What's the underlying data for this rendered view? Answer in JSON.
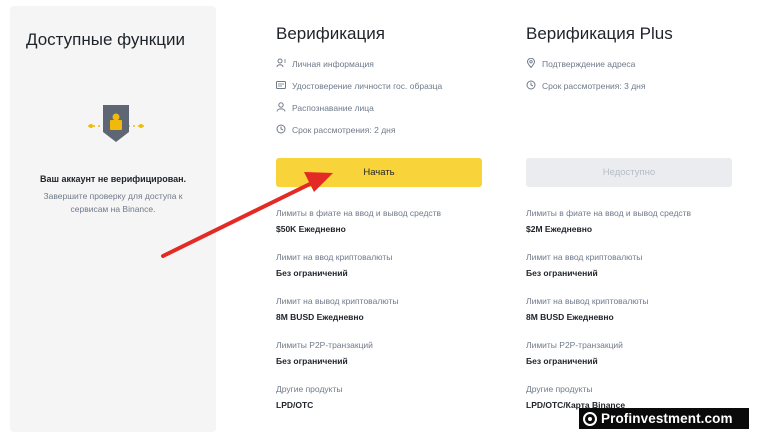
{
  "left_panel": {
    "title": "Доступные функции",
    "status": "Ваш аккаунт не верифицирован.",
    "description": "Завершите проверку для доступа к сервисам на Binance."
  },
  "verification": {
    "title": "Верификация",
    "features": [
      {
        "icon": "user-info-icon",
        "label": "Личная информация"
      },
      {
        "icon": "id-card-icon",
        "label": "Удостоверение личности гос. образца"
      },
      {
        "icon": "face-icon",
        "label": "Распознавание лица"
      },
      {
        "icon": "clock-icon",
        "label": "Срок рассмотрения: 2 дня"
      }
    ],
    "button_label": "Начать",
    "limits": [
      {
        "label": "Лимиты в фиате на ввод и вывод средств",
        "value": "$50K Ежедневно"
      },
      {
        "label": "Лимит на ввод криптовалюты",
        "value": "Без ограничений"
      },
      {
        "label": "Лимит на вывод криптовалюты",
        "value": "8M BUSD Ежедневно"
      },
      {
        "label": "Лимиты P2P-транзакций",
        "value": "Без ограничений"
      },
      {
        "label": "Другие продукты",
        "value": "LPD/OTC"
      }
    ]
  },
  "verification_plus": {
    "title": "Верификация Plus",
    "features": [
      {
        "icon": "location-icon",
        "label": "Подтверждение адреса"
      },
      {
        "icon": "clock-icon",
        "label": "Срок рассмотрения: 3 дня"
      }
    ],
    "button_label": "Недоступно",
    "limits": [
      {
        "label": "Лимиты в фиате на ввод и вывод средств",
        "value": "$2M Ежедневно"
      },
      {
        "label": "Лимит на ввод криптовалюты",
        "value": "Без ограничений"
      },
      {
        "label": "Лимит на вывод криптовалюты",
        "value": "8M BUSD Ежедневно"
      },
      {
        "label": "Лимиты P2P-транзакций",
        "value": "Без ограничений"
      },
      {
        "label": "Другие продукты",
        "value": "LPD/OTC/Карта Binance"
      }
    ]
  },
  "watermark": {
    "text": "Profinvestment.com"
  },
  "colors": {
    "accent_yellow": "#f8d33a",
    "arrow_red": "#e32a24",
    "shield_gray": "#5e6673",
    "panel_bg": "#f5f5f5"
  }
}
